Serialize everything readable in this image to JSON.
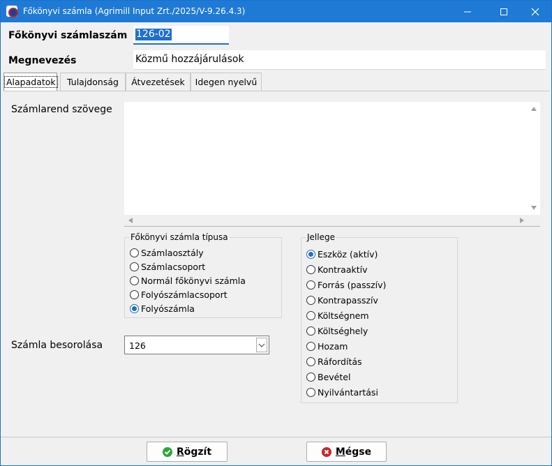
{
  "window": {
    "title": "Főkönyvi számla (Agrimill Input Zrt./2025/V-9.26.4.3)",
    "controls": [
      "minimize-icon",
      "maximize-icon",
      "close-icon"
    ]
  },
  "header": {
    "code_label": "Főkönyvi számlaszám",
    "code_value": "126-02",
    "name_label": "Megnevezés",
    "name_value": "Közmű hozzájárulások"
  },
  "tabs": [
    {
      "label": "Alapadatok",
      "active": true
    },
    {
      "label": "Tulajdonság",
      "active": false
    },
    {
      "label": "Átvezetések",
      "active": false
    },
    {
      "label": "Idegen nyelvű",
      "active": false
    }
  ],
  "main": {
    "memo_label": "Számlarend szövege",
    "memo_value": "",
    "type_group": {
      "title": "Főkönyvi számla típusa",
      "options": [
        "Számlaosztály",
        "Számlacsoport",
        "Normál főkönyvi számla",
        "Folyószámlacsoport",
        "Folyószámla"
      ],
      "selected": "Folyószámla"
    },
    "nature_group": {
      "title": "Jellege",
      "options": [
        "Eszköz (aktív)",
        "Kontraaktív",
        "Forrás (passzív)",
        "Kontrapasszív",
        "Költségnem",
        "Költséghely",
        "Hozam",
        "Ráfordítás",
        "Bevétel",
        "Nyilvántartási"
      ],
      "selected": "Eszköz (aktív)"
    },
    "classification_label": "Számla besorolása",
    "classification_value": "126"
  },
  "buttons": {
    "save_accel": "R",
    "save_rest": "ögzít",
    "cancel_accel": "M",
    "cancel_rest": "égse"
  },
  "colors": {
    "titlebar": "#1f7ad6",
    "accent": "#1f6fc6",
    "save_icon": "#2aa837",
    "cancel_icon": "#c9262b"
  }
}
